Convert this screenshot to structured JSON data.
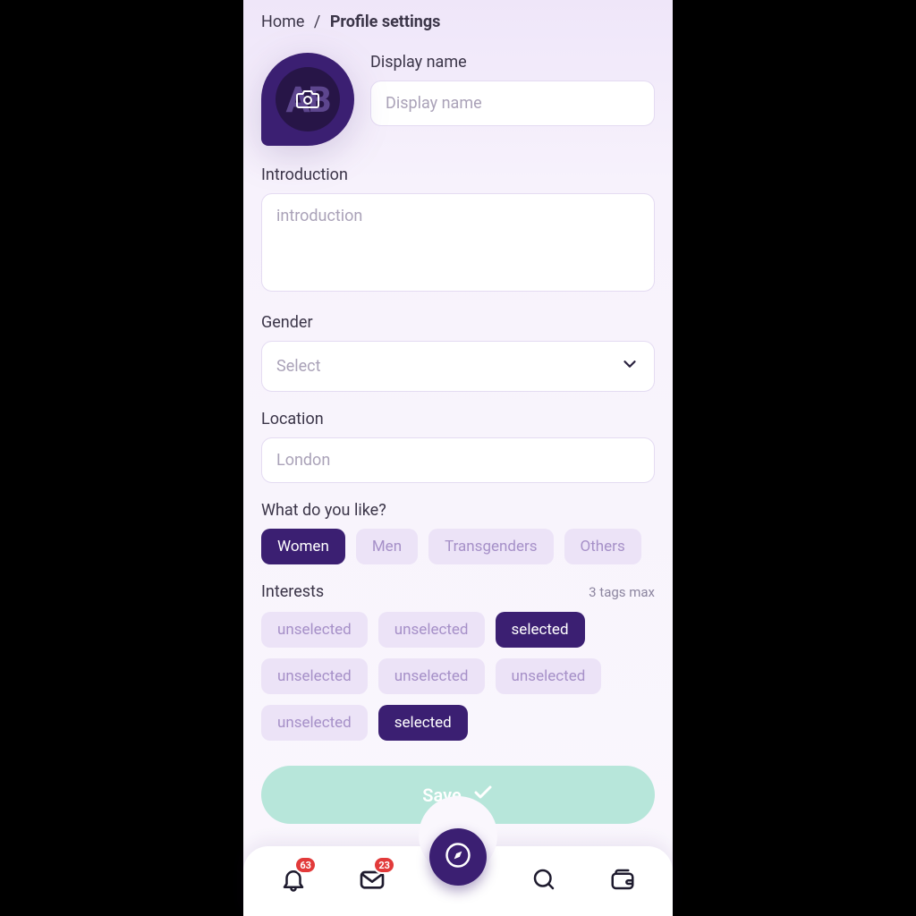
{
  "breadcrumb": {
    "home": "Home",
    "current": "Profile settings"
  },
  "avatar": {
    "initials": "AB"
  },
  "display_name": {
    "label": "Display name",
    "placeholder": "Display name",
    "value": ""
  },
  "introduction": {
    "label": "Introduction",
    "placeholder": "introduction",
    "value": ""
  },
  "gender": {
    "label": "Gender",
    "selected": "Select"
  },
  "location": {
    "label": "Location",
    "value": "London"
  },
  "preferences": {
    "label": "What do you like?",
    "options": [
      {
        "label": "Women",
        "selected": true
      },
      {
        "label": "Men",
        "selected": false
      },
      {
        "label": "Transgenders",
        "selected": false
      },
      {
        "label": "Others",
        "selected": false
      }
    ]
  },
  "interests": {
    "label": "Interests",
    "hint": "3 tags max",
    "tags": [
      {
        "label": "unselected",
        "selected": false
      },
      {
        "label": "unselected",
        "selected": false
      },
      {
        "label": "selected",
        "selected": true
      },
      {
        "label": "unselected",
        "selected": false
      },
      {
        "label": "unselected",
        "selected": false
      },
      {
        "label": "unselected",
        "selected": false
      },
      {
        "label": "unselected",
        "selected": false
      },
      {
        "label": "selected",
        "selected": true
      }
    ]
  },
  "save_label": "Save",
  "nav": {
    "notifications_badge": "63",
    "messages_badge": "23"
  },
  "colors": {
    "brand": "#3b1f72",
    "chip_bg": "#ece3f7",
    "save": "#b7e6da",
    "badge": "#e23a3a"
  }
}
